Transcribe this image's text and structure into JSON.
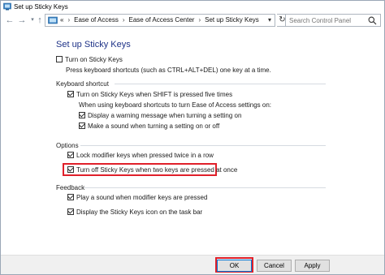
{
  "window": {
    "title": "Set up Sticky Keys"
  },
  "address_bar": {
    "prefix": "«",
    "crumbs": [
      "Ease of Access",
      "Ease of Access Center",
      "Set up Sticky Keys"
    ]
  },
  "search": {
    "placeholder": "Search Control Panel"
  },
  "page": {
    "heading": "Set up Sticky Keys",
    "turn_on": {
      "label": "Turn on Sticky Keys",
      "checked": false
    },
    "turn_on_desc": "Press keyboard shortcuts (such as CTRL+ALT+DEL) one key at a time.",
    "keyboard_shortcut": {
      "title": "Keyboard shortcut",
      "shift_five": {
        "label": "Turn on Sticky Keys when SHIFT is pressed five times",
        "checked": true
      },
      "note": "When using keyboard shortcuts to turn Ease of Access settings on:",
      "warning_msg": {
        "label": "Display a warning message when turning a setting on",
        "checked": true
      },
      "sound_msg": {
        "label": "Make a sound when turning a setting on or off",
        "checked": true
      }
    },
    "options": {
      "title": "Options",
      "lock_modifier": {
        "label": "Lock modifier keys when pressed twice in a row",
        "checked": true
      },
      "turn_off_two": {
        "label": "Turn off Sticky Keys when two keys are pressed at once",
        "checked": true
      }
    },
    "feedback": {
      "title": "Feedback",
      "play_sound": {
        "label": "Play a sound when modifier keys are pressed",
        "checked": true
      },
      "display_icon": {
        "label": "Display the Sticky Keys icon on the task bar",
        "checked": true
      }
    }
  },
  "buttons": {
    "ok": "OK",
    "cancel": "Cancel",
    "apply": "Apply"
  },
  "colors": {
    "heading": "#1e3287",
    "highlight": "#e0202a",
    "accent": "#0078d7"
  }
}
